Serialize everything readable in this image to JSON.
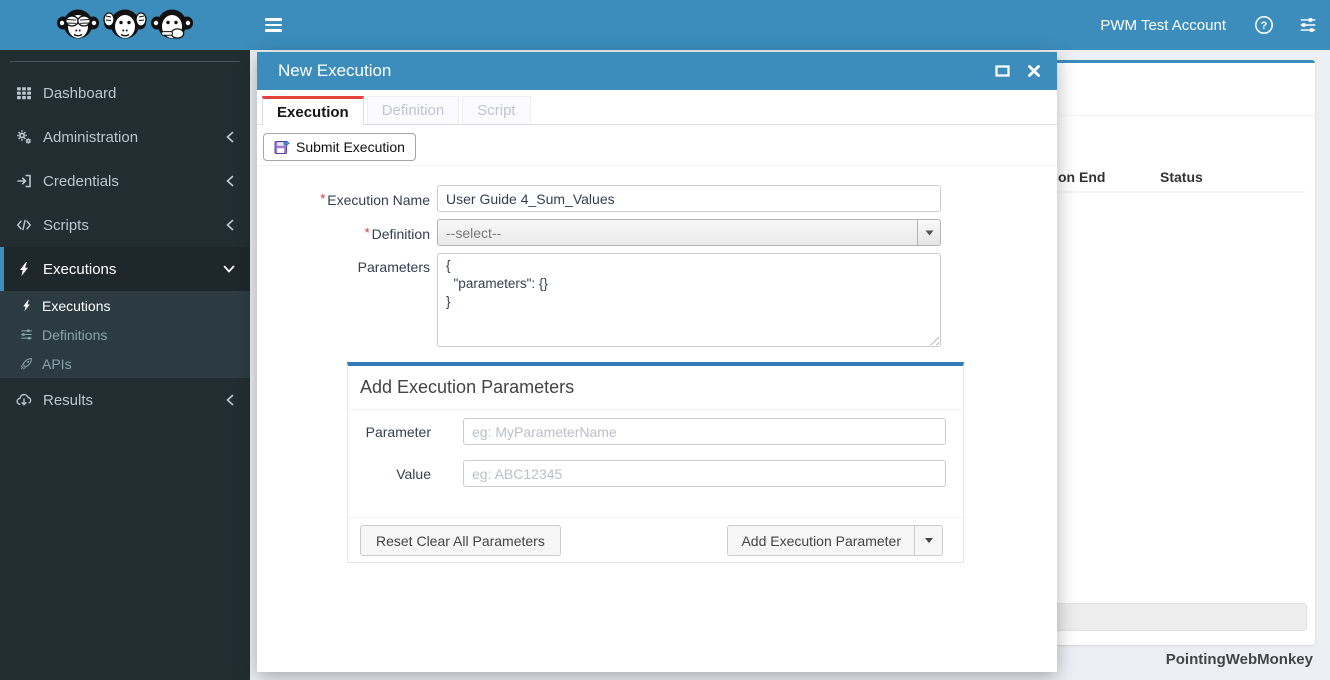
{
  "theme": {
    "primary_blue": "#3c8dbc",
    "sidebar_bg": "#222d32",
    "submenu_bg": "#2c3b41",
    "content_bg": "#ecf0f5",
    "active_tab_accent": "#e8423d"
  },
  "navbar": {
    "account_label": "PWM Test Account",
    "icons": [
      "hamburger-icon",
      "help-icon",
      "sliders-icon"
    ]
  },
  "logo": {
    "icons": [
      "see-no-evil-monkey-icon",
      "hear-no-evil-monkey-icon",
      "speak-no-evil-monkey-icon"
    ]
  },
  "sidebar": {
    "items": [
      {
        "label": "Dashboard",
        "icon": "grid-icon",
        "chevron": ""
      },
      {
        "label": "Administration",
        "icon": "gears-icon",
        "chevron": "left"
      },
      {
        "label": "Credentials",
        "icon": "sign-in-icon",
        "chevron": "left"
      },
      {
        "label": "Scripts",
        "icon": "code-icon",
        "chevron": "left"
      },
      {
        "label": "Executions",
        "icon": "bolt-icon",
        "chevron": "down",
        "active": true
      },
      {
        "label": "Results",
        "icon": "cloud-download-icon",
        "chevron": "left"
      }
    ],
    "submenu": [
      {
        "label": "Executions",
        "icon": "bolt-icon",
        "active": true
      },
      {
        "label": "Definitions",
        "icon": "sliders-icon",
        "active": false
      },
      {
        "label": "APIs",
        "icon": "rocket-icon",
        "active": false
      }
    ]
  },
  "modal": {
    "title": "New Execution",
    "required_marker": "*",
    "tabs": [
      {
        "label": "Execution",
        "active": true
      },
      {
        "label": "Definition",
        "active": false
      },
      {
        "label": "Script",
        "active": false
      }
    ],
    "submit_button_label": "Submit Execution",
    "fields": {
      "execution_name": {
        "label": "Execution Name",
        "value": "User Guide 4_Sum_Values"
      },
      "definition": {
        "label": "Definition",
        "selected": "--select--"
      },
      "parameters": {
        "label": "Parameters",
        "value": "{\n  \"parameters\": {}\n}"
      }
    },
    "add_parameters_section": {
      "title": "Add Execution Parameters",
      "parameter_label": "Parameter",
      "parameter_placeholder": "eg: MyParameterName",
      "value_label": "Value",
      "value_placeholder": "eg: ABC12345",
      "reset_button_label": "Reset Clear All Parameters",
      "add_button_label": "Add Execution Parameter"
    }
  },
  "background_panel": {
    "table_header_fragments": [
      "on End",
      "Status"
    ]
  },
  "footer": {
    "brand": "PointingWebMonkey"
  }
}
